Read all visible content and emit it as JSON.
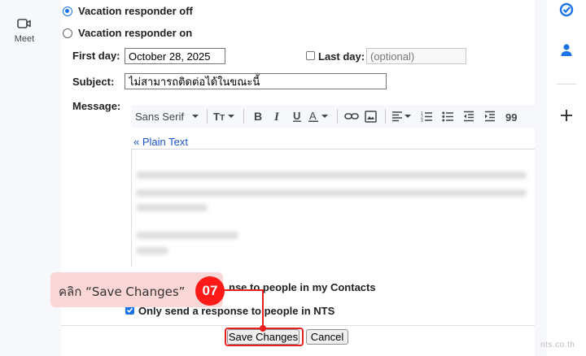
{
  "rail": {
    "meet_label": "Meet"
  },
  "vacation": {
    "off_label": "Vacation responder off",
    "on_label": "Vacation responder on",
    "first_day_label": "First day:",
    "first_day_value": "October 28, 2025",
    "last_day_label": "Last day:",
    "last_day_placeholder": "(optional)",
    "subject_label": "Subject:",
    "subject_value": "ไม่สามารถติดต่อได้ในขณะนี้",
    "message_label": "Message:"
  },
  "toolbar": {
    "font_name": "Sans Serif",
    "items": [
      "font-size-icon",
      "bold-icon",
      "italic-icon",
      "underline-icon",
      "text-color-icon",
      "link-icon",
      "image-icon",
      "align-icon",
      "numbered-list-icon",
      "bulleted-list-icon",
      "indent-less-icon",
      "indent-more-icon",
      "quote-icon"
    ]
  },
  "editor": {
    "plain_text_link": "« Plain Text"
  },
  "options": {
    "contacts_label_visible": "nse to people in my Contacts",
    "nts_label": "Only send a response to people in NTS"
  },
  "buttons": {
    "save": "Save Changes",
    "cancel": "Cancel"
  },
  "annotation": {
    "callout": "คลิก “Save Changes”",
    "step": "07"
  },
  "watermark": "nts.co.th",
  "colors": {
    "accent": "#1a73e8",
    "annotation_red": "#e62020",
    "callout_bg": "#fbd6d6",
    "link": "#1a55c4"
  }
}
